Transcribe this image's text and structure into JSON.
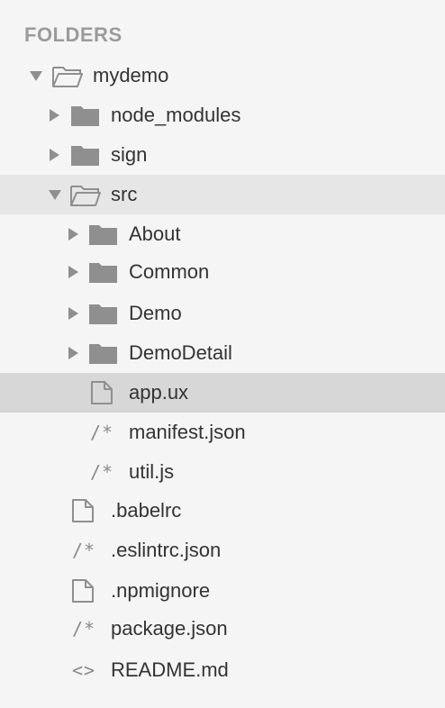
{
  "sidebar": {
    "header": "FOLDERS",
    "tree": [
      {
        "label": "mydemo",
        "type": "folder",
        "expanded": true,
        "icon": "folder-open-icon"
      },
      {
        "label": "node_modules",
        "type": "folder",
        "expanded": false,
        "icon": "folder-icon"
      },
      {
        "label": "sign",
        "type": "folder",
        "expanded": false,
        "icon": "folder-icon"
      },
      {
        "label": "src",
        "type": "folder",
        "expanded": true,
        "icon": "folder-open-icon"
      },
      {
        "label": "About",
        "type": "folder",
        "expanded": false,
        "icon": "folder-icon"
      },
      {
        "label": "Common",
        "type": "folder",
        "expanded": false,
        "icon": "folder-icon"
      },
      {
        "label": "Demo",
        "type": "folder",
        "expanded": false,
        "icon": "folder-icon"
      },
      {
        "label": "DemoDetail",
        "type": "folder",
        "expanded": false,
        "icon": "folder-icon"
      },
      {
        "label": "app.ux",
        "type": "file",
        "icon": "file-icon"
      },
      {
        "label": "manifest.json",
        "type": "file",
        "icon": "json-icon"
      },
      {
        "label": "util.js",
        "type": "file",
        "icon": "js-icon"
      },
      {
        "label": ".babelrc",
        "type": "file",
        "icon": "file-icon"
      },
      {
        "label": ".eslintrc.json",
        "type": "file",
        "icon": "json-icon"
      },
      {
        "label": ".npmignore",
        "type": "file",
        "icon": "file-icon"
      },
      {
        "label": "package.json",
        "type": "file",
        "icon": "json-icon"
      },
      {
        "label": "README.md",
        "type": "file",
        "icon": "markdown-icon"
      }
    ],
    "glyphs": {
      "json": "/*",
      "js": "/*",
      "markdown": "<>"
    }
  },
  "colors": {
    "background": "#f5f5f5",
    "selected_row": "#e6e6e6",
    "highlight_row": "#d7d7d7",
    "header": "#9b9b9b",
    "icon": "#8f8f8f"
  }
}
